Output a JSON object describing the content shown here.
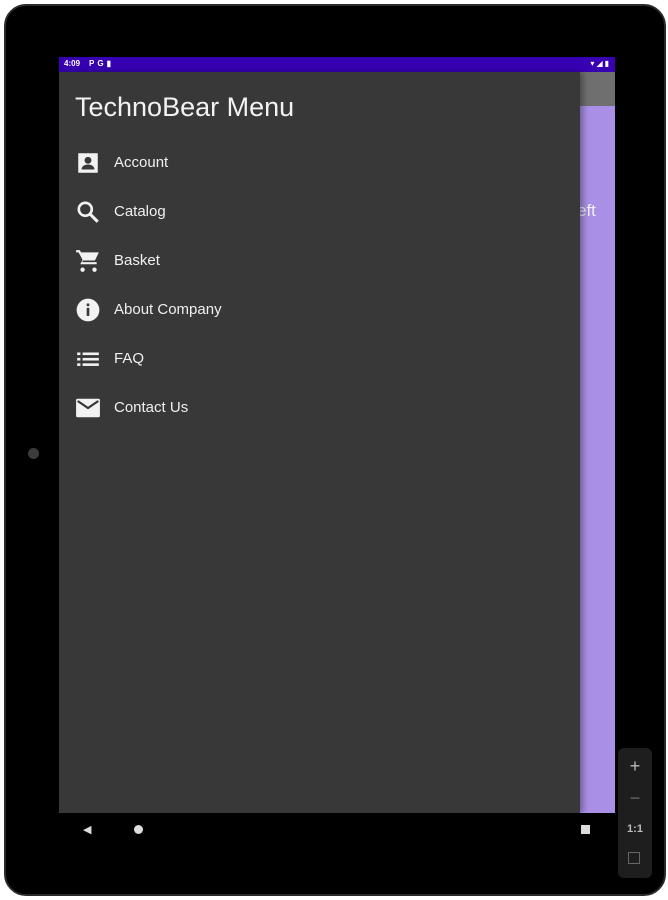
{
  "status_bar": {
    "time": "4:09",
    "left_icons": [
      "notification-p-icon",
      "notification-g-icon",
      "sim-card-icon"
    ],
    "right_icons": [
      "wifi-icon",
      "signal-icon",
      "battery-icon"
    ]
  },
  "background": {
    "partial_text": "eft",
    "appbar_color": "#6f6f6f",
    "content_color": "#a98fe5"
  },
  "drawer": {
    "title": "TechnoBear Menu",
    "items": [
      {
        "label": "Account",
        "icon": "account-box-icon"
      },
      {
        "label": "Catalog",
        "icon": "search-icon"
      },
      {
        "label": "Basket",
        "icon": "cart-icon"
      },
      {
        "label": "About Company",
        "icon": "info-icon"
      },
      {
        "label": "FAQ",
        "icon": "list-icon"
      },
      {
        "label": "Contact Us",
        "icon": "mail-icon"
      }
    ]
  },
  "nav_bar": {
    "back": "◀",
    "home": "home-circle",
    "recents": "recents-square"
  },
  "emulator_toolbar": {
    "zoom_in": "+",
    "zoom_out": "−",
    "actual_size": "1:1",
    "screenshot": "screenshot-icon"
  },
  "colors": {
    "status_bar": "#3700b3",
    "drawer_bg": "#383838",
    "text": "#f0f0f0"
  }
}
